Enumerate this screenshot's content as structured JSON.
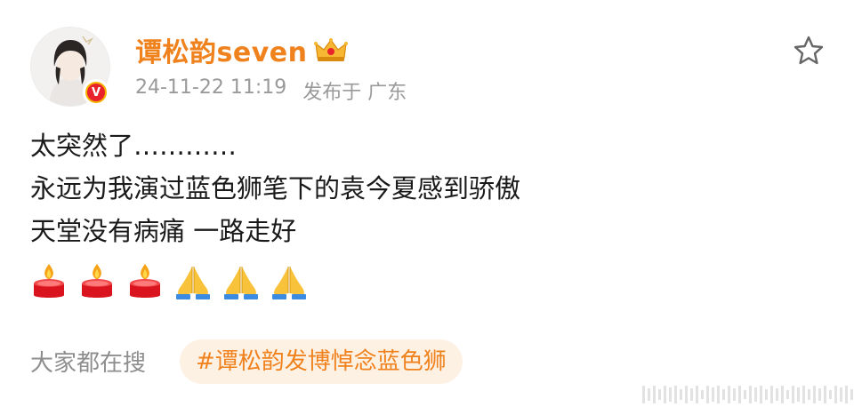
{
  "user": {
    "name": "谭松韵seven",
    "verified_badge": "V"
  },
  "post": {
    "date": "24-11-22 11:19",
    "location": "发布于 广东",
    "lines": [
      "太突然了…………",
      "永远为我演过蓝色狮笔下的袁今夏感到骄傲",
      "天堂没有病痛 一路走好"
    ],
    "emojis": [
      "candle-icon",
      "candle-icon",
      "candle-icon",
      "pray-icon",
      "pray-icon",
      "pray-icon"
    ]
  },
  "trending": {
    "label": "大家都在搜",
    "hashtag": "#谭松韵发博悼念蓝色狮"
  },
  "colors": {
    "accent": "#f0821e",
    "hashtag_bg": "#fdf1e4",
    "meta": "#9a9a9a"
  }
}
